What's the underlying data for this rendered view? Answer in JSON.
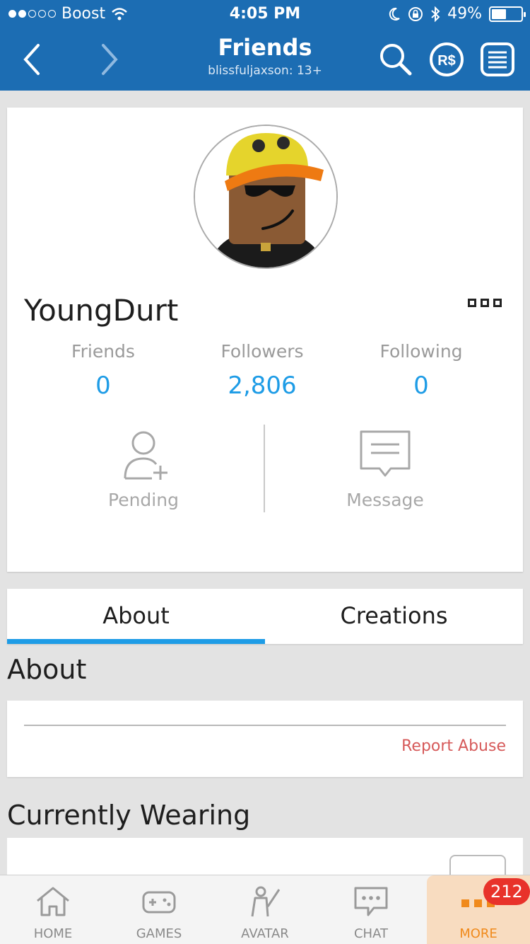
{
  "status_bar": {
    "carrier": "Boost",
    "time": "4:05 PM",
    "battery": "49%",
    "battery_level": 0.49
  },
  "nav": {
    "title": "Friends",
    "subtitle": "blissfuljaxson: 13+",
    "icons": [
      "back-icon",
      "forward-icon",
      "search-icon",
      "robux-icon",
      "menu-list-icon"
    ]
  },
  "profile": {
    "username": "YoungDurt",
    "stats": [
      {
        "label": "Friends",
        "value": "0"
      },
      {
        "label": "Followers",
        "value": "2,806"
      },
      {
        "label": "Following",
        "value": "0"
      }
    ],
    "actions": [
      {
        "label": "Pending",
        "icon": "add-friend-icon"
      },
      {
        "label": "Message",
        "icon": "message-icon"
      }
    ]
  },
  "tabs": [
    {
      "label": "About",
      "active": true
    },
    {
      "label": "Creations",
      "active": false
    }
  ],
  "about": {
    "title": "About",
    "report_label": "Report Abuse"
  },
  "wearing": {
    "title": "Currently Wearing"
  },
  "tabbar": {
    "items": [
      {
        "label": "HOME",
        "icon": "home-icon"
      },
      {
        "label": "GAMES",
        "icon": "gamepad-icon"
      },
      {
        "label": "AVATAR",
        "icon": "avatar-icon"
      },
      {
        "label": "CHAT",
        "icon": "chat-icon"
      },
      {
        "label": "MORE",
        "icon": "more-icon",
        "active": true
      }
    ],
    "badge": "212"
  },
  "colors": {
    "nav_bg": "#1c6db3",
    "accent": "#1e9ce6",
    "report": "#d65a5a",
    "badge": "#e8322a",
    "more_active": "#f08a1c"
  }
}
